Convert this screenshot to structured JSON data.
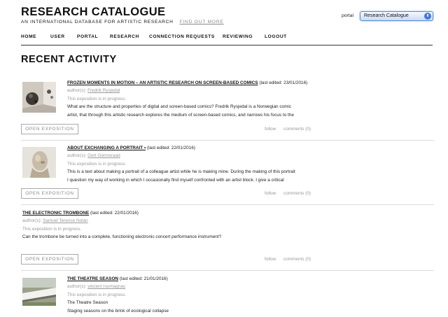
{
  "header": {
    "title": "RESEARCH CATALOGUE",
    "subtitle": "AN INTERNATIONAL DATABASE FOR ARTISTIC RESEARCH",
    "find_more": "FIND OUT MORE",
    "portal_label": "portal",
    "portal_selected": "Research Catalogue"
  },
  "nav": [
    "HOME",
    "USER",
    "PORTAL",
    "RESEARCH",
    "CONNECTION REQUESTS",
    "REVIEWING",
    "LOGOUT"
  ],
  "section_title": "RECENT ACTIVITY",
  "entries": [
    {
      "title": "FROZEN MOMENTS IN MOTION – AN ARTISTIC RESEARCH ON SCREEN-BASED COMICS",
      "date": "(last edited: 23/01/2016)",
      "author_prefix": "author(s):",
      "author": "Fredrik Rysjedal",
      "status": "This exposition is in progress.",
      "desc1": "What are the structure and properties of digital and screen-based comics? Fredrik Rysjedal is a Norwegian comic",
      "desc2": "artist, that through this artistic research explores the medium of screen-based comics, and narrows his focus to the",
      "open": "OPEN EXPOSITION",
      "follow": "follow",
      "comments": "comments (0)"
    },
    {
      "title": "ABOUT EXCHANGING A PORTRAIT •",
      "date": "(last edited: 22/01/2016)",
      "author_prefix": "author(s):",
      "author": "Gert Germeraad",
      "status": "This exposition is in progress.",
      "desc1": "This is a text about making a portrait of a colleague artist while he is making mine. During the making of this portrait",
      "desc2": "I question my way of working in which I occasionally find myself confronted with an artist block. I give a critical",
      "open": "OPEN EXPOSITION",
      "follow": "follow",
      "comments": "comments (0)"
    },
    {
      "title": "THE ELECTRONIC TROMBONE",
      "date": "(last edited: 22/01/2016)",
      "author_prefix": "author(s):",
      "author": "Samuel Terence Nolan",
      "status": "This exposition is in progress.",
      "desc1": "Can the trombone be turned into a complete, functioning electronic concert performance instrument?",
      "open": "OPEN EXPOSITION",
      "follow": "follow",
      "comments": "comments (0)"
    },
    {
      "title": "THE THEATRE SEASON",
      "date": "(last edited: 21/01/2016)",
      "author_prefix": "author(s):",
      "author": "vincent roumagnac",
      "status": "This exposition is in progress.",
      "desc1": "The Theatre Season",
      "desc2": "Staging seasons on the brink of ecological collapse"
    }
  ]
}
